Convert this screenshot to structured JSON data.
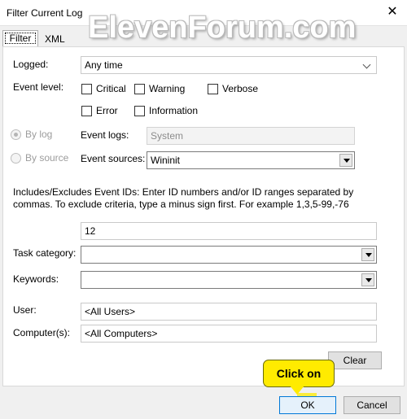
{
  "window": {
    "title": "Filter Current Log",
    "close_glyph": "✕"
  },
  "watermark": "ElevenForum.com",
  "tabs": [
    {
      "label": "Filter"
    },
    {
      "label": "XML"
    }
  ],
  "form": {
    "logged": {
      "label": "Logged:",
      "value": "Any time"
    },
    "event_level": {
      "label": "Event level:",
      "options": [
        "Critical",
        "Warning",
        "Verbose",
        "Error",
        "Information"
      ]
    },
    "by_log": {
      "label": "By log",
      "selected": true
    },
    "by_source": {
      "label": "By source",
      "selected": false
    },
    "event_logs": {
      "label": "Event logs:",
      "value": "System"
    },
    "event_sources": {
      "label": "Event sources:",
      "value": "Wininit"
    },
    "description": "Includes/Excludes Event IDs: Enter ID numbers and/or ID ranges separated by commas. To exclude criteria, type a minus sign first. For example 1,3,5-99,-76",
    "event_ids": {
      "value": "12"
    },
    "task_category": {
      "label": "Task category:",
      "value": ""
    },
    "keywords": {
      "label": "Keywords:",
      "value": ""
    },
    "user": {
      "label": "User:",
      "value": "<All Users>"
    },
    "computers": {
      "label": "Computer(s):",
      "value": "<All Computers>"
    }
  },
  "buttons": {
    "clear": "Clear",
    "ok": "OK",
    "cancel": "Cancel"
  },
  "callout": {
    "text": "Click on",
    "color": "#ffeb00"
  }
}
